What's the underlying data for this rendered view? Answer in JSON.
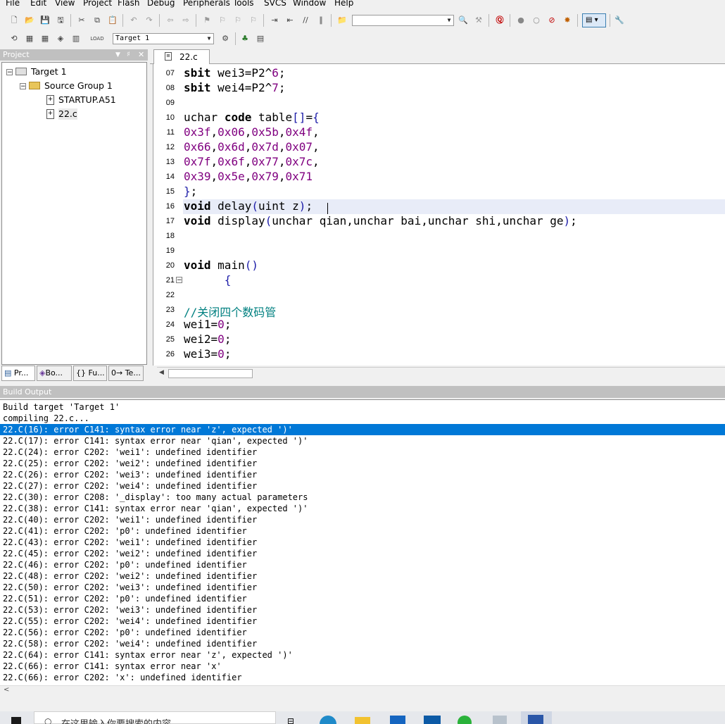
{
  "menu": [
    "File",
    "Edit",
    "View",
    "Project",
    "Flash",
    "Debug",
    "Peripherals",
    "Tools",
    "SVCS",
    "Window",
    "Help"
  ],
  "toolbar": {
    "target_select": "Target 1",
    "find_combo_value": ""
  },
  "project_panel": {
    "title": "Project",
    "tree": {
      "target": "Target 1",
      "group": "Source Group 1",
      "files": [
        "STARTUP.A51",
        "22.c"
      ]
    },
    "tabs": [
      "Pr...",
      "Bo...",
      "{} Fu...",
      "0→ Te..."
    ]
  },
  "editor": {
    "tab": "22.c",
    "lines": [
      {
        "n": "07",
        "code": "sbit wei3=P2^6;"
      },
      {
        "n": "08",
        "code": "sbit wei4=P2^7;"
      },
      {
        "n": "09",
        "code": ""
      },
      {
        "n": "10",
        "code": "uchar code table[]={"
      },
      {
        "n": "11",
        "code": "0x3f,0x06,0x5b,0x4f,"
      },
      {
        "n": "12",
        "code": "0x66,0x6d,0x7d,0x07,"
      },
      {
        "n": "13",
        "code": "0x7f,0x6f,0x77,0x7c,"
      },
      {
        "n": "14",
        "code": "0x39,0x5e,0x79,0x71"
      },
      {
        "n": "15",
        "code": "};"
      },
      {
        "n": "16",
        "code": "void delay(uint z);"
      },
      {
        "n": "17",
        "code": "void display(unchar qian,unchar bai,unchar shi,unchar ge);"
      },
      {
        "n": "18",
        "code": ""
      },
      {
        "n": "19",
        "code": ""
      },
      {
        "n": "20",
        "code": "void main()"
      },
      {
        "n": "21",
        "code": "      {"
      },
      {
        "n": "22",
        "code": ""
      },
      {
        "n": "23",
        "code": "//关闭四个数码管"
      },
      {
        "n": "24",
        "code": "wei1=0;"
      },
      {
        "n": "25",
        "code": "wei2=0;"
      },
      {
        "n": "26",
        "code": "wei3=0;"
      }
    ]
  },
  "build_output": {
    "title": "Build Output",
    "lines": [
      "Build target 'Target 1'",
      "compiling 22.c...",
      "22.C(16): error C141: syntax error near 'z', expected ')'",
      "22.C(17): error C141: syntax error near 'qian', expected ')'",
      "22.C(24): error C202: 'wei1': undefined identifier",
      "22.C(25): error C202: 'wei2': undefined identifier",
      "22.C(26): error C202: 'wei3': undefined identifier",
      "22.C(27): error C202: 'wei4': undefined identifier",
      "22.C(30): error C208: '_display': too many actual parameters",
      "22.C(38): error C141: syntax error near 'qian', expected ')'",
      "22.C(40): error C202: 'wei1': undefined identifier",
      "22.C(41): error C202: 'p0': undefined identifier",
      "22.C(43): error C202: 'wei1': undefined identifier",
      "22.C(45): error C202: 'wei2': undefined identifier",
      "22.C(46): error C202: 'p0': undefined identifier",
      "22.C(48): error C202: 'wei2': undefined identifier",
      "22.C(50): error C202: 'wei3': undefined identifier",
      "22.C(51): error C202: 'p0': undefined identifier",
      "22.C(53): error C202: 'wei3': undefined identifier",
      "22.C(55): error C202: 'wei4': undefined identifier",
      "22.C(56): error C202: 'p0': undefined identifier",
      "22.C(58): error C202: 'wei4': undefined identifier",
      "22.C(64): error C141: syntax error near 'z', expected ')'",
      "22.C(66): error C141: syntax error near 'x'",
      "22.C(66): error C202: 'x': undefined identifier"
    ],
    "selected_index": 2
  },
  "taskbar": {
    "search_placeholder": "在这里输入你要搜索的内容"
  },
  "colors": {
    "selection": "#0078d7",
    "current_line": "#e8ecf8",
    "keyword": "#000000",
    "number": "#800080",
    "comment": "#008080"
  }
}
